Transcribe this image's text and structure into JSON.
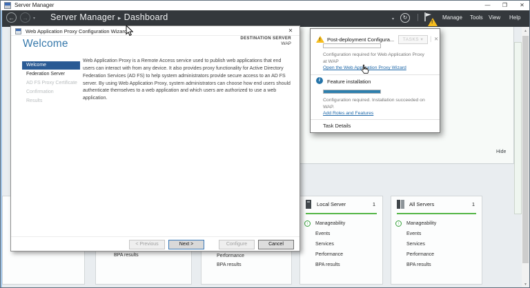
{
  "window": {
    "title": "Server Manager"
  },
  "icons": {
    "minimize": "—",
    "maximize": "❐",
    "close": "✕",
    "back": "←",
    "forward": "→",
    "dropdown": "▾",
    "refresh": "↻",
    "divider": "|",
    "breadcrumb_sep": "▸",
    "warning_mark": "!",
    "info_mark": "i",
    "tasks_caret": "▾",
    "flyout_close": "✕",
    "dialog_close": "✕",
    "up_arrow": "↑",
    "scroll_up": "▲",
    "scroll_down": "▼"
  },
  "navbar": {
    "breadcrumb_root": "Server Manager",
    "breadcrumb_page": "Dashboard",
    "menu": [
      "Manage",
      "Tools",
      "View",
      "Help"
    ]
  },
  "wizard": {
    "title": "Web Application Proxy Configuration Wizard",
    "heading": "Welcome",
    "destination_label": "DESTINATION SERVER",
    "destination_value": "WAP",
    "nav": [
      "Welcome",
      "Federation Server",
      "AD FS Proxy Certificate",
      "Confirmation",
      "Results"
    ],
    "body": "Web Application Proxy is a Remote Access service used to publish web applications that end users can interact with from any device. It also provides proxy functionality for Active Directory Federation Services (AD FS) to help system administrators provide secure access to an AD FS server. By using Web Application Proxy, system administrators can choose how end users should authenticate themselves to a web application and which users are authorized to use a web application.",
    "buttons": {
      "previous": "< Previous",
      "next": "Next >",
      "configure": "Configure",
      "cancel": "Cancel"
    }
  },
  "flyout": {
    "title": "Post-deployment Configura...",
    "tasks_label": "TASKS",
    "item1": {
      "message": "Configuration required for Web Application Proxy at WAP",
      "link": "Open the Web Application Proxy Wizard",
      "progress_pct": 0
    },
    "item2": {
      "title": "Feature installation",
      "message": "Configuration required. Installation succeeded on WAP.",
      "link": "Add Roles and Features",
      "progress_pct": 100
    },
    "task_details": "Task Details"
  },
  "dashboard": {
    "hide_label": "Hide",
    "metrics": [
      "Manageability",
      "Events",
      "Services",
      "Performance",
      "BPA results"
    ],
    "tiles": [
      {
        "name": "Local Server",
        "count": "1"
      },
      {
        "name": "All Servers",
        "count": "1"
      }
    ]
  },
  "colors": {
    "accent_green": "#53b545",
    "selection_blue": "#2a5a94",
    "link_blue": "#1b66a8",
    "progress_blue": "#2e7fad",
    "warning_yellow": "#f6bd1e",
    "navbar_dark": "#34383c"
  }
}
